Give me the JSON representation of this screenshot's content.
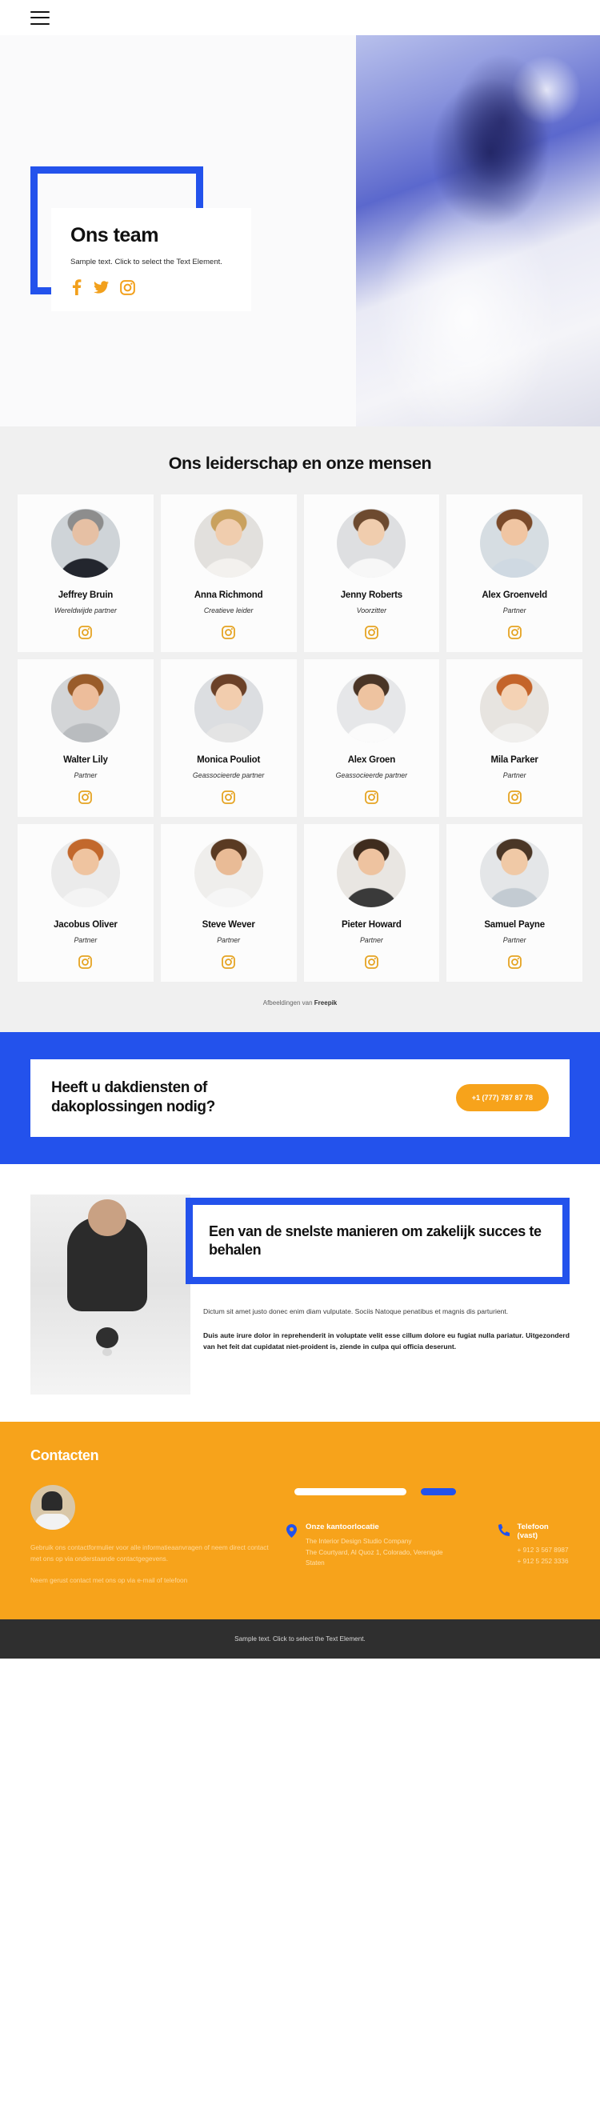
{
  "header": {
    "menu_icon": "hamburger-menu-icon"
  },
  "hero": {
    "title": "Ons team",
    "subtitle": "Sample text. Click to select the Text Element.",
    "socials": [
      {
        "name": "facebook-icon",
        "label": "Facebook"
      },
      {
        "name": "twitter-icon",
        "label": "Twitter"
      },
      {
        "name": "instagram-icon",
        "label": "Instagram"
      }
    ]
  },
  "team": {
    "heading": "Ons leiderschap en onze mensen",
    "credit_prefix": "Afbeeldingen van ",
    "credit_source": "Freepik",
    "members": [
      {
        "name": "Jeffrey Bruin",
        "role": "Wereldwijde partner",
        "avatar_bg": "#cfd4d8",
        "skin": "#e6c0a4",
        "hair": "#8d8d8d",
        "cloth": "#23262e"
      },
      {
        "name": "Anna Richmond",
        "role": "Creatieve leider",
        "avatar_bg": "#e2e0dd",
        "skin": "#f0cdae",
        "hair": "#c9a15e",
        "cloth": "#f3f1ee"
      },
      {
        "name": "Jenny Roberts",
        "role": "Voorzitter",
        "avatar_bg": "#dedfe1",
        "skin": "#f0cdae",
        "hair": "#6d4a2f",
        "cloth": "#f7f7f7"
      },
      {
        "name": "Alex Groenveld",
        "role": "Partner",
        "avatar_bg": "#d6dde2",
        "skin": "#f0c5a2",
        "hair": "#7a4a2a",
        "cloth": "#cfd9e2"
      },
      {
        "name": "Walter Lily",
        "role": "Partner",
        "avatar_bg": "#d3d5d7",
        "skin": "#edbd9b",
        "hair": "#9a5c2a",
        "cloth": "#b9bcbf"
      },
      {
        "name": "Monica Pouliot",
        "role": "Geassocieerde partner",
        "avatar_bg": "#dcdee1",
        "skin": "#f2cdae",
        "hair": "#6b4128",
        "cloth": "#e4e4e4"
      },
      {
        "name": "Alex Groen",
        "role": "Geassocieerde partner",
        "avatar_bg": "#e6e7e9",
        "skin": "#eec3a0",
        "hair": "#4a3526",
        "cloth": "#fbfbfb"
      },
      {
        "name": "Mila Parker",
        "role": "Partner",
        "avatar_bg": "#e7e4e0",
        "skin": "#f4d2b4",
        "hair": "#c4642a",
        "cloth": "#f0efed"
      },
      {
        "name": "Jacobus Oliver",
        "role": "Partner",
        "avatar_bg": "#ebebeb",
        "skin": "#efc4a0",
        "hair": "#c2682c",
        "cloth": "#f4f4f4"
      },
      {
        "name": "Steve Wever",
        "role": "Partner",
        "avatar_bg": "#efeeec",
        "skin": "#e9bb96",
        "hair": "#5a3a22",
        "cloth": "#f6f6f6"
      },
      {
        "name": "Pieter Howard",
        "role": "Partner",
        "avatar_bg": "#e9e6e2",
        "skin": "#eec3a0",
        "hair": "#3f2c1e",
        "cloth": "#3a3a3a"
      },
      {
        "name": "Samuel Payne",
        "role": "Partner",
        "avatar_bg": "#e4e6e8",
        "skin": "#f0c9a6",
        "hair": "#4a3626",
        "cloth": "#c3cbd2"
      }
    ],
    "social_icon": "instagram-icon"
  },
  "cta": {
    "heading": "Heeft u dakdiensten of dakoplossingen nodig?",
    "button_label": "+1 (777) 787 87 78"
  },
  "feature": {
    "title": "Een van de snelste manieren om zakelijk succes te behalen",
    "paragraph_1": "Dictum sit amet justo donec enim diam vulputate. Sociis Natoque penatibus et magnis dis parturient.",
    "paragraph_2": "Duis aute irure dolor in reprehenderit in voluptate velit esse cillum dolore eu fugiat nulla pariatur. Uitgezonderd van het feit dat cupidatat niet-proident is, ziende in culpa qui officia deserunt."
  },
  "contact": {
    "heading": "Contacten",
    "avatar_name": "contact-avatar",
    "text_1": "Gebruik ons contactformulier voor alle informatieaanvragen of neem direct contact met ons op via onderstaande contactgegevens.",
    "text_2": "Neem gerust contact met ons op via e-mail of telefoon",
    "office": {
      "icon": "map-pin-icon",
      "title": "Onze kantoorlocatie",
      "line_1": "The Interior Design Studio Company",
      "line_2": "The Courtyard, Al Quoz 1, Colorado, Verenigde Staten"
    },
    "phone": {
      "icon": "phone-icon",
      "title": "Telefoon (vast)",
      "line_1": "+ 912 3 567 8987",
      "line_2": "+ 912 5 252 3336"
    }
  },
  "footer": {
    "text": "Sample text. Click to select the Text Element."
  },
  "colors": {
    "blue": "#2352ec",
    "orange": "#f7a31b",
    "gray_section": "#f0f0f0",
    "dark_footer": "#2f2f2f"
  }
}
